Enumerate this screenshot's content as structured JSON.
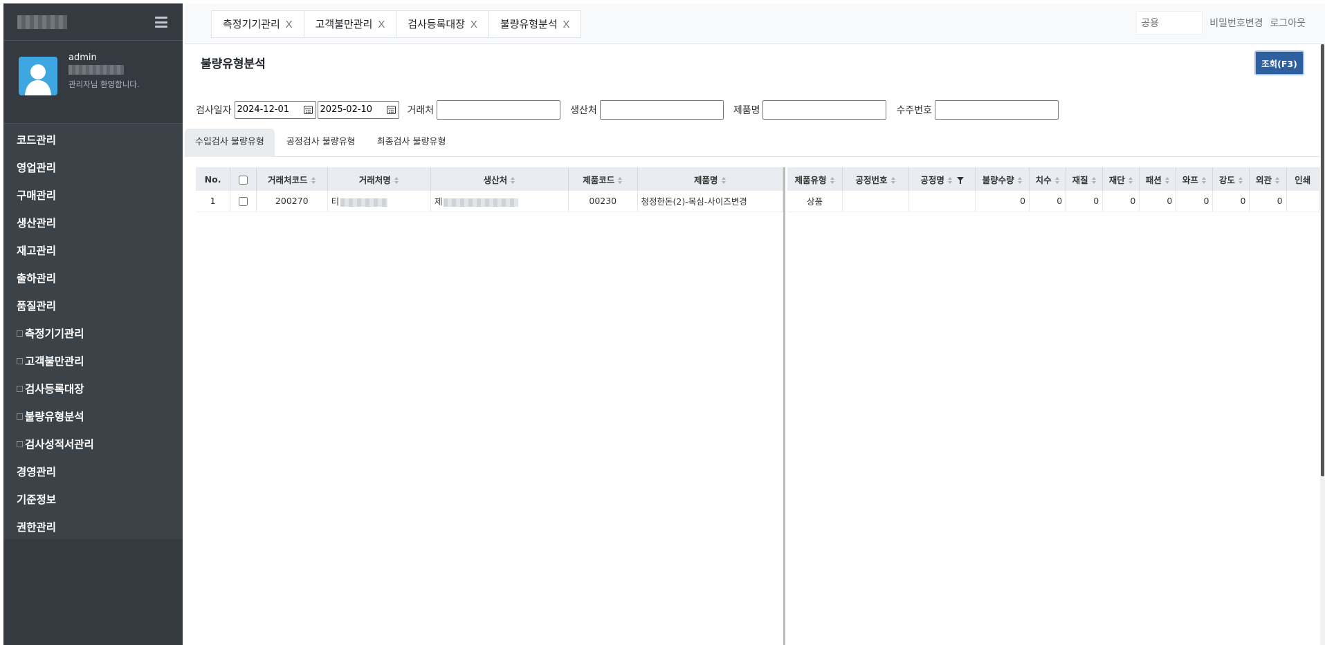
{
  "user": {
    "name": "admin",
    "welcome": "관리자님 환영합니다."
  },
  "sidebar": {
    "items": [
      {
        "label": "코드관리"
      },
      {
        "label": "영업관리"
      },
      {
        "label": "구매관리"
      },
      {
        "label": "생산관리"
      },
      {
        "label": "재고관리"
      },
      {
        "label": "출하관리"
      },
      {
        "label": "품질관리"
      },
      {
        "label": "측정기기관리"
      },
      {
        "label": "고객불만관리"
      },
      {
        "label": "검사등록대장"
      },
      {
        "label": "불량유형분석"
      },
      {
        "label": "검사성적서관리"
      },
      {
        "label": "경영관리"
      },
      {
        "label": "기준정보"
      },
      {
        "label": "권한관리"
      }
    ]
  },
  "tabs": [
    {
      "label": "측정기기관리",
      "close": "X"
    },
    {
      "label": "고객불만관리",
      "close": "X"
    },
    {
      "label": "검사등록대장",
      "close": "X"
    },
    {
      "label": "불량유형분석",
      "close": "X"
    }
  ],
  "header": {
    "common_value": "공용",
    "change_password": "비밀번호변경",
    "logout": "로그아웃"
  },
  "page": {
    "title": "불량유형분석",
    "search_button": "조회(F3)"
  },
  "filters": {
    "inspect_date_label": "검사일자",
    "date_from": "2024-12-01",
    "date_to": "2025-02-10",
    "customer_label": "거래처",
    "producer_label": "생산처",
    "product_label": "제품명",
    "order_label": "수주번호"
  },
  "sub_tabs": [
    {
      "label": "수입검사 불량유형"
    },
    {
      "label": "공정검사 불량유형"
    },
    {
      "label": "최종검사 불량유형"
    }
  ],
  "grid": {
    "left_headers": {
      "no": "No.",
      "customer_code": "거래처코드",
      "customer_name": "거래처명",
      "producer": "생산처",
      "product_code": "제품코드",
      "product_name": "제품명"
    },
    "right_headers": [
      "제품유형",
      "공정번호",
      "공정명",
      "불량수량",
      "치수",
      "재질",
      "재단",
      "패션",
      "와프",
      "강도",
      "외관",
      "인쇄"
    ],
    "rows": [
      {
        "no": "1",
        "customer_code": "200270",
        "customer_name_prefix": "티",
        "producer_prefix": "제",
        "product_code": "00230",
        "product_name": "청정한돈(2)-목심-사이즈변경",
        "product_type": "상품",
        "process_no": "",
        "process_name": "",
        "defect_qty": "0",
        "dimension": "0",
        "material": "0",
        "cutting": "0",
        "fashion": "0",
        "warp": "0",
        "strength": "0",
        "appearance": "0",
        "printing": ""
      }
    ]
  },
  "colors": {
    "sidebar_bg": "#343a40",
    "button_bg": "#2e5f9e",
    "header_bg": "#e9edf2"
  }
}
